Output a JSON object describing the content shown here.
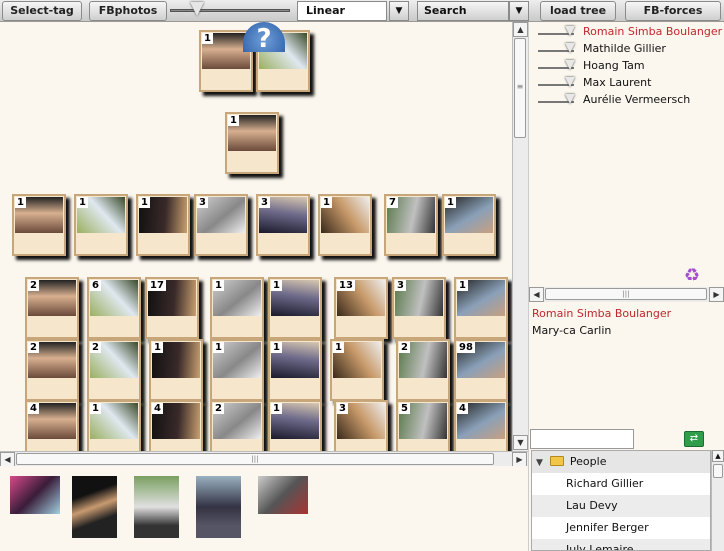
{
  "toolbar": {
    "select_tag": "Select-tag",
    "fbphotos": "FBphotos",
    "layout_select": "Linear",
    "search_label": "Search",
    "load_tree": "load tree",
    "fb_forces": "FB-forces",
    "dropdown_glyph": "▼"
  },
  "help": {
    "glyph": "?"
  },
  "scroll": {
    "up": "▲",
    "down": "▼",
    "left": "◀",
    "right": "▶",
    "grip": "|||",
    "vgrip": "≡"
  },
  "cards": {
    "row1": [
      {
        "count": "1"
      },
      {
        "count": "1"
      }
    ],
    "row2": [
      {
        "count": "1"
      }
    ],
    "row3": [
      {
        "count": "1"
      },
      {
        "count": "1"
      },
      {
        "count": "1"
      },
      {
        "count": "3"
      },
      {
        "count": "3"
      },
      {
        "count": "1"
      },
      {
        "count": "7"
      },
      {
        "count": "1"
      }
    ],
    "row4": [
      {
        "count": "2"
      },
      {
        "count": "6"
      },
      {
        "count": "17"
      },
      {
        "count": "1"
      },
      {
        "count": "1"
      },
      {
        "count": "13"
      },
      {
        "count": "3"
      },
      {
        "count": "1"
      }
    ],
    "row5": [
      {
        "count": "2"
      },
      {
        "count": "2"
      },
      {
        "count": "1"
      },
      {
        "count": "1"
      },
      {
        "count": "1"
      },
      {
        "count": "1"
      },
      {
        "count": "2"
      },
      {
        "count": "98"
      }
    ],
    "row6": [
      {
        "count": "4"
      },
      {
        "count": "1"
      },
      {
        "count": "4"
      },
      {
        "count": "2"
      },
      {
        "count": "1"
      },
      {
        "count": "3"
      },
      {
        "count": "5"
      },
      {
        "count": "4"
      }
    ]
  },
  "people_sliders": [
    {
      "name": "Romain Simba Boulanger",
      "color": "#c0272d"
    },
    {
      "name": "Mathilde Gillier",
      "color": "#111111"
    },
    {
      "name": "Hoang Tam",
      "color": "#111111"
    },
    {
      "name": "Max Laurent",
      "color": "#111111"
    },
    {
      "name": "Aurélie Vermeersch",
      "color": "#111111"
    }
  ],
  "selected_people": [
    {
      "name": "Romain Simba Boulanger",
      "color": "#c0272d"
    },
    {
      "name": "Mary-ca Carlin",
      "color": "#111111"
    }
  ],
  "recycle_glyph": "♻",
  "go_glyph": "⇄",
  "tree": {
    "root": "People",
    "root_toggle": "▼",
    "items": [
      "Richard Gillier",
      "Lau Devy",
      "Jennifer Berger",
      "July Lemaire"
    ]
  },
  "colors": {
    "accent_red": "#c0272d",
    "card_bg": "#f5e6cc",
    "card_border": "#c7a67a"
  }
}
